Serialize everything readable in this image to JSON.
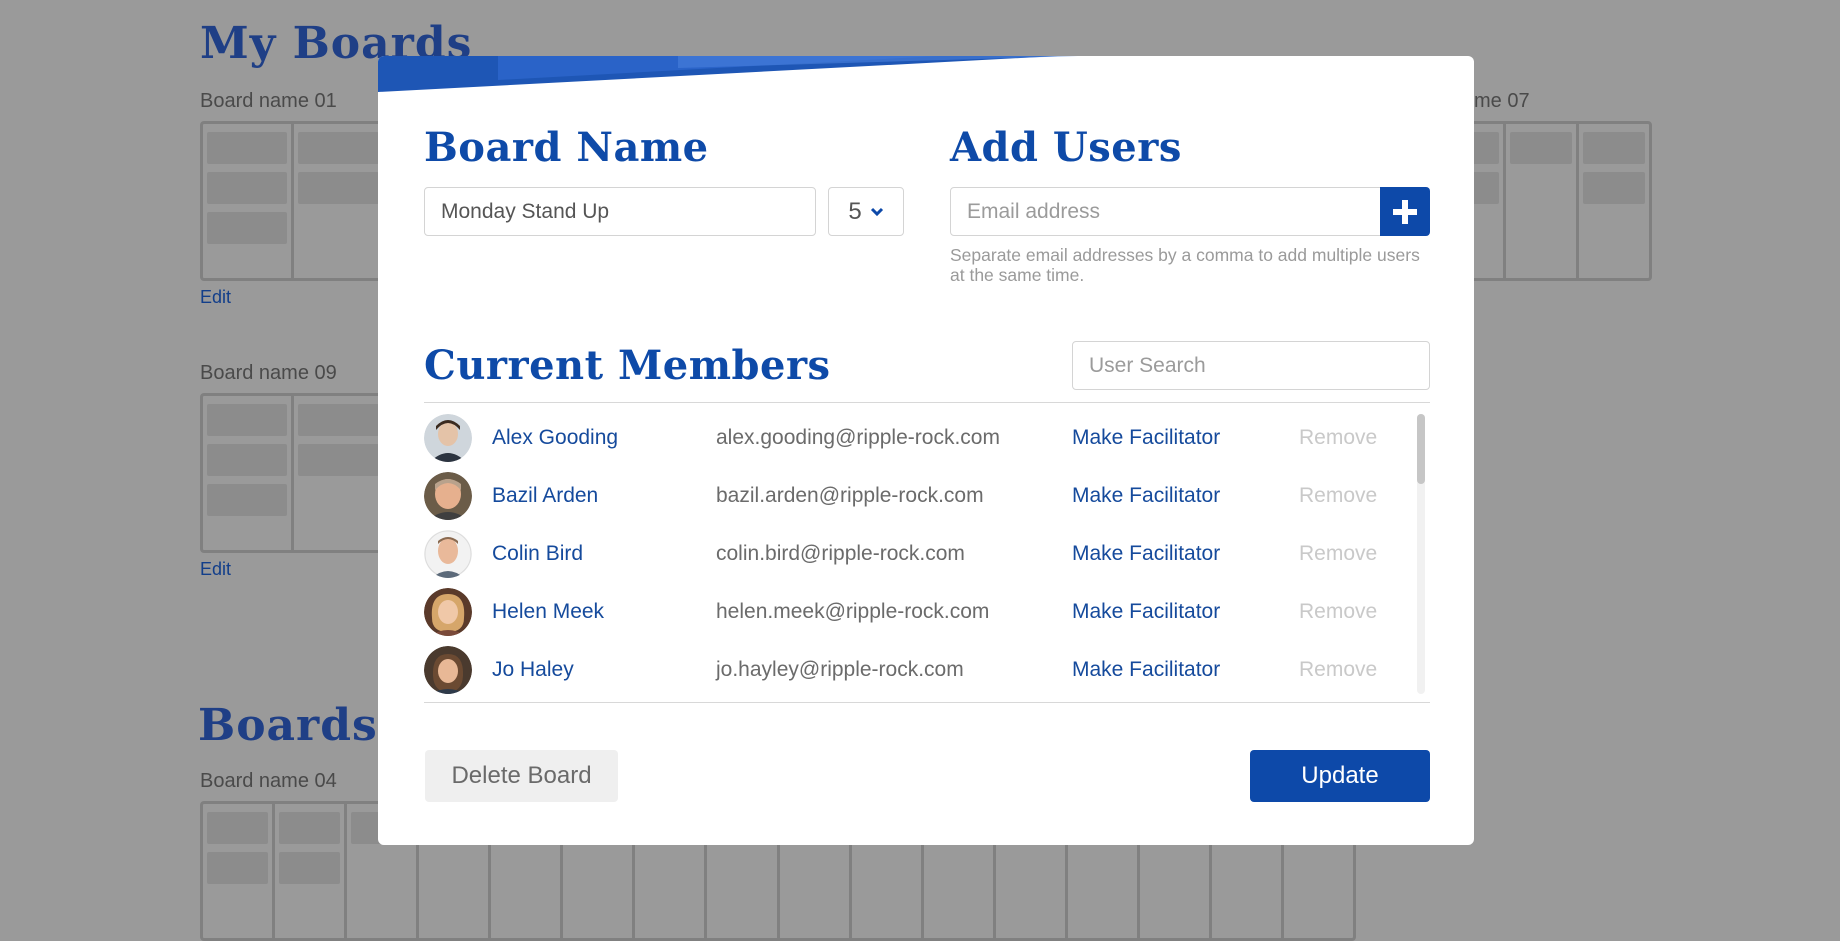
{
  "background": {
    "headings": [
      "My Boards",
      "Boards s"
    ],
    "boards": [
      {
        "title": "Board name 01",
        "edit": "Edit"
      },
      {
        "title": "me 07"
      },
      {
        "title": "Board name 09",
        "edit": "Edit"
      },
      {
        "title": "Board name 04"
      }
    ]
  },
  "modal": {
    "board_name": {
      "title": "Board Name",
      "value": "Monday Stand Up",
      "select_value": "5"
    },
    "add_users": {
      "title": "Add Users",
      "email_placeholder": "Email address",
      "hint": "Separate email addresses by a comma to add multiple users at the same time."
    },
    "current_members": {
      "title": "Current Members",
      "search_placeholder": "User Search",
      "action_label": "Make Facilitator",
      "remove_label": "Remove",
      "members": [
        {
          "name": "Alex Gooding",
          "email": "alex.gooding@ripple-rock.com",
          "action": "Make Facilitator",
          "remove": "Remove"
        },
        {
          "name": "Bazil Arden",
          "email": "bazil.arden@ripple-rock.com",
          "action": "Make Facilitator",
          "remove": "Remove"
        },
        {
          "name": "Colin Bird",
          "email": "colin.bird@ripple-rock.com",
          "action": "Make Facilitator",
          "remove": "Remove"
        },
        {
          "name": "Helen Meek",
          "email": "helen.meek@ripple-rock.com",
          "action": "Make Facilitator",
          "remove": "Remove"
        },
        {
          "name": "Jo Haley",
          "email": "jo.hayley@ripple-rock.com",
          "action": "Make Facilitator",
          "remove": "Remove"
        }
      ]
    },
    "buttons": {
      "delete": "Delete Board",
      "update": "Update"
    }
  },
  "colors": {
    "accent": "#0d49a9",
    "overlay": "#9a9a9a",
    "link": "#154a9c"
  }
}
